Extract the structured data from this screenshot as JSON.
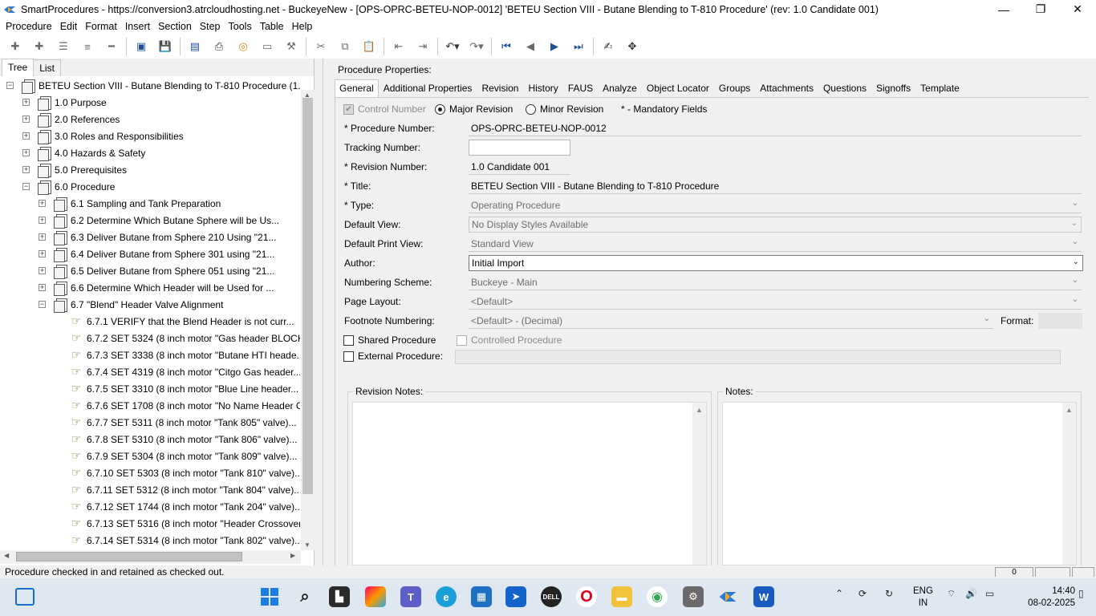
{
  "window": {
    "title": "SmartProcedures - https://conversion3.atrcloudhosting.net - BuckeyeNew - [OPS-OPRC-BETEU-NOP-0012] 'BETEU Section VIII - Butane Blending to T-810 Procedure' (rev: 1.0 Candidate 001)",
    "minimize": "—",
    "restore": "❐",
    "close": "✕"
  },
  "menu": [
    "Procedure",
    "Edit",
    "Format",
    "Insert",
    "Section",
    "Step",
    "Tools",
    "Table",
    "Help"
  ],
  "toolbar": {
    "icons": [
      "add-sibling-icon",
      "add-child-icon",
      "list-icon",
      "indent-list-icon",
      "minus-icon",
      "save-open-icon",
      "save-icon",
      "publish-icon",
      "print-icon",
      "refresh-icon",
      "preview-icon",
      "tools-icon",
      "cut-icon",
      "copy-icon",
      "paste-icon",
      "outdent-icon",
      "indent-icon",
      "undo-icon",
      "redo-icon",
      "first-icon",
      "prev-icon",
      "next-icon",
      "last-icon",
      "spellcheck-icon",
      "move-icon"
    ]
  },
  "left": {
    "tabs": [
      "Tree",
      "List"
    ],
    "active_tab": "Tree",
    "tree": [
      {
        "label": "BETEU Section VIII - Butane Blending to T-810 Procedure (1.0...",
        "level": 0,
        "expander": "−",
        "kind": "doc"
      },
      {
        "label": "1.0 Purpose",
        "level": 1,
        "expander": "+",
        "kind": "doc"
      },
      {
        "label": "2.0 References",
        "level": 1,
        "expander": "+",
        "kind": "doc"
      },
      {
        "label": "3.0 Roles and Responsibilities",
        "level": 1,
        "expander": "+",
        "kind": "doc"
      },
      {
        "label": "4.0 Hazards & Safety",
        "level": 1,
        "expander": "+",
        "kind": "doc"
      },
      {
        "label": "5.0 Prerequisites",
        "level": 1,
        "expander": "+",
        "kind": "doc"
      },
      {
        "label": "6.0 Procedure",
        "level": 1,
        "expander": "−",
        "kind": "doc"
      },
      {
        "label": "6.1 Sampling and Tank Preparation",
        "level": 2,
        "expander": "+",
        "kind": "doc"
      },
      {
        "label": "6.2 Determine Which Butane Sphere will be Us...",
        "level": 2,
        "expander": "+",
        "kind": "doc"
      },
      {
        "label": "6.3 Deliver Butane from Sphere 210 Using \"21...",
        "level": 2,
        "expander": "+",
        "kind": "doc"
      },
      {
        "label": "6.4 Deliver Butane from Sphere 301 using \"21...",
        "level": 2,
        "expander": "+",
        "kind": "doc"
      },
      {
        "label": "6.5 Deliver Butane from Sphere 051 using \"21...",
        "level": 2,
        "expander": "+",
        "kind": "doc"
      },
      {
        "label": "6.6 Determine Which Header will be Used for ...",
        "level": 2,
        "expander": "+",
        "kind": "doc"
      },
      {
        "label": "6.7 \"Blend\" Header Valve Alignment",
        "level": 2,
        "expander": "−",
        "kind": "doc"
      },
      {
        "label": "6.7.1 VERIFY that the Blend Header is not curr...",
        "level": 3,
        "expander": "",
        "kind": "step"
      },
      {
        "label": "6.7.2 SET 5324 (8 inch motor \"Gas header BLOCK...",
        "level": 3,
        "expander": "",
        "kind": "step"
      },
      {
        "label": "6.7.3 SET 3338 (8 inch motor \"Butane HTI heade...",
        "level": 3,
        "expander": "",
        "kind": "step"
      },
      {
        "label": "6.7.4 SET 4319 (8 inch motor \"Citgo Gas header...",
        "level": 3,
        "expander": "",
        "kind": "step"
      },
      {
        "label": "6.7.5 SET 3310 (8 inch motor \"Blue Line header...",
        "level": 3,
        "expander": "",
        "kind": "step"
      },
      {
        "label": "6.7.6 SET 1708 (8 inch motor \"No Name Header C...",
        "level": 3,
        "expander": "",
        "kind": "step"
      },
      {
        "label": "6.7.7 SET 5311 (8 inch motor \"Tank 805\" valve)...",
        "level": 3,
        "expander": "",
        "kind": "step"
      },
      {
        "label": "6.7.8 SET 5310 (8 inch motor \"Tank 806\" valve)...",
        "level": 3,
        "expander": "",
        "kind": "step"
      },
      {
        "label": "6.7.9 SET 5304 (8 inch motor \"Tank 809\" valve)...",
        "level": 3,
        "expander": "",
        "kind": "step"
      },
      {
        "label": "6.7.10 SET 5303 (8 inch motor \"Tank 810\" valve)...",
        "level": 3,
        "expander": "",
        "kind": "step"
      },
      {
        "label": "6.7.11 SET 5312 (8 inch motor \"Tank 804\" valve)...",
        "level": 3,
        "expander": "",
        "kind": "step"
      },
      {
        "label": "6.7.12 SET 1744 (8 inch motor \"Tank 204\" valve)...",
        "level": 3,
        "expander": "",
        "kind": "step"
      },
      {
        "label": "6.7.13 SET 5316 (8 inch motor \"Header Crossover...",
        "level": 3,
        "expander": "",
        "kind": "step"
      },
      {
        "label": "6.7.14 SET 5314 (8 inch motor \"Tank 802\" valve)...",
        "level": 3,
        "expander": "",
        "kind": "step"
      }
    ]
  },
  "right": {
    "heading": "Procedure Properties:",
    "tabs": [
      "General",
      "Additional Properties",
      "Revision",
      "History",
      "FAUS",
      "Analyze",
      "Object Locator",
      "Groups",
      "Attachments",
      "Questions",
      "Signoffs",
      "Template"
    ],
    "active_tab": "General",
    "control_number": "Control Number",
    "major_revision": "Major Revision",
    "minor_revision": "Minor Revision",
    "mandatory": "* - Mandatory Fields",
    "fields": {
      "procedure_number_label": "* Procedure Number:",
      "procedure_number": "OPS-OPRC-BETEU-NOP-0012",
      "tracking_number_label": "Tracking Number:",
      "tracking_number": "",
      "revision_number_label": "* Revision Number:",
      "revision_number": "1.0 Candidate 001",
      "title_label": "* Title:",
      "title": "BETEU Section VIII - Butane Blending to T-810 Procedure",
      "type_label": "* Type:",
      "type": "Operating Procedure",
      "default_view_label": "Default View:",
      "default_view": "No Display Styles Available",
      "default_print_view_label": "Default Print View:",
      "default_print_view": "Standard View",
      "author_label": "Author:",
      "author": "Initial Import",
      "numbering_scheme_label": "Numbering Scheme:",
      "numbering_scheme": "Buckeye - Main",
      "page_layout_label": "Page Layout:",
      "page_layout": "<Default>",
      "footnote_numbering_label": "Footnote Numbering:",
      "footnote_numbering": "<Default> - (Decimal)",
      "format_label": "Format:",
      "format": ""
    },
    "shared_procedure": "Shared Procedure",
    "controlled_procedure": "Controlled Procedure",
    "external_procedure": "External Procedure:",
    "revision_notes_label": "Revision Notes:",
    "notes_label": "Notes:"
  },
  "status": {
    "message": "Procedure checked in and retained as checked out.",
    "counter": "0"
  },
  "taskbar": {
    "lang_top": "ENG",
    "lang_bottom": "IN",
    "time": "14:40",
    "date": "08-02-2025"
  },
  "colors": {
    "accent_blue": "#1f4e9a",
    "taskbar_bg": "#dfe7f1",
    "window_bg": "#f0f0f0"
  }
}
